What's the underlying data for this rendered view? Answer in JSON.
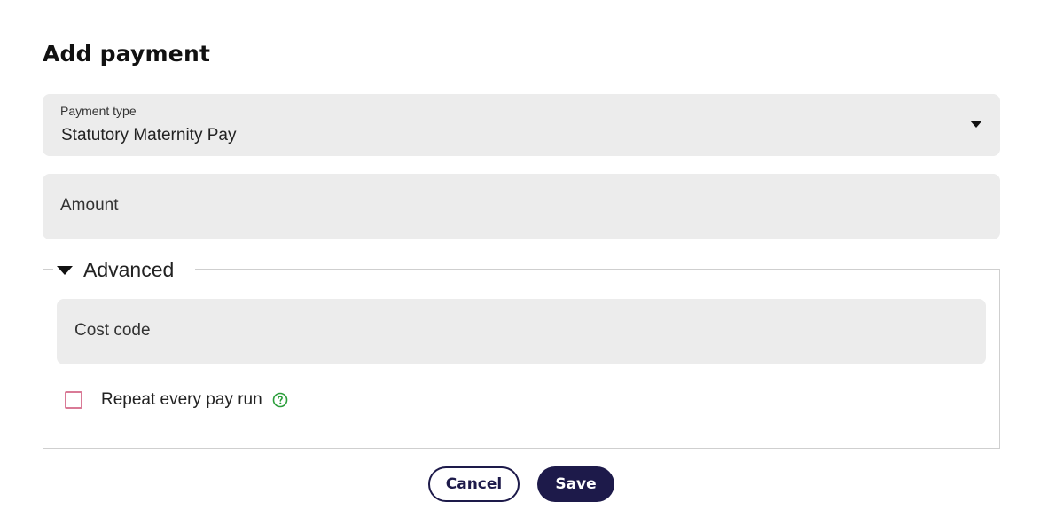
{
  "dialog": {
    "title": "Add payment"
  },
  "payment_type": {
    "label": "Payment type",
    "value": "Statutory Maternity Pay"
  },
  "amount": {
    "placeholder": "Amount"
  },
  "advanced": {
    "label": "Advanced",
    "expanded": true,
    "cost_code": {
      "placeholder": "Cost code"
    },
    "repeat": {
      "label": "Repeat every pay run",
      "checked": false
    }
  },
  "buttons": {
    "cancel": "Cancel",
    "save": "Save"
  },
  "icons": {
    "dropdown": "chevron-down-icon",
    "advanced_toggle": "triangle-down-icon",
    "help": "help-circle-icon"
  },
  "colors": {
    "primary": "#1d1a4a",
    "field_bg": "#ececec",
    "checkbox_border": "#d97a96",
    "help_icon": "#2a9d3a",
    "fieldset_border": "#cfcfcf"
  }
}
